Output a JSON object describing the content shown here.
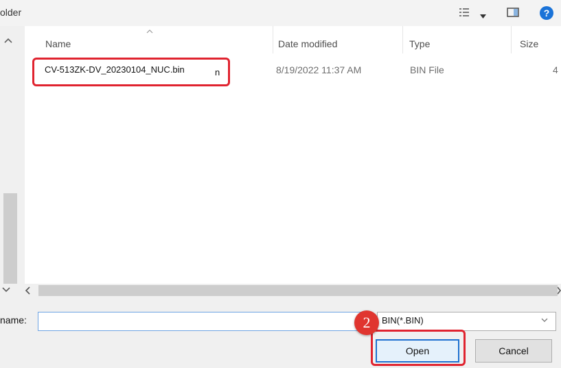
{
  "toolbar": {
    "title_fragment": "older",
    "view_menu_icon": "list-view-icon",
    "dropdown_icon": "caret-down-icon",
    "preview_pane_icon": "preview-pane-icon",
    "help_icon": "help-icon",
    "help_glyph": "?"
  },
  "columns": [
    {
      "label": "Name"
    },
    {
      "label": "Date modified"
    },
    {
      "label": "Type"
    },
    {
      "label": "Size"
    }
  ],
  "file": {
    "name": "CV-513ZK-DV_20230104_NUC.bin",
    "name_tail": "n",
    "date_modified": "8/19/2022 11:37 AM",
    "type": "BIN File",
    "size_fragment": "4"
  },
  "scrollbars": {
    "up_arrow": "^",
    "down_arrow": "v",
    "left_arrow": "<",
    "right_arrow": ">"
  },
  "bottom": {
    "file_name_label": "name:",
    "file_name_value": "",
    "filter_selected": "BIN(*.BIN)",
    "filter_arrow": "v",
    "open_label": "Open",
    "cancel_label": "Cancel",
    "step_badge": "2"
  },
  "colors": {
    "highlight": "#e0232f",
    "badge": "#e0352f",
    "primary_border": "#1d70d0",
    "help": "#1a73d8"
  }
}
